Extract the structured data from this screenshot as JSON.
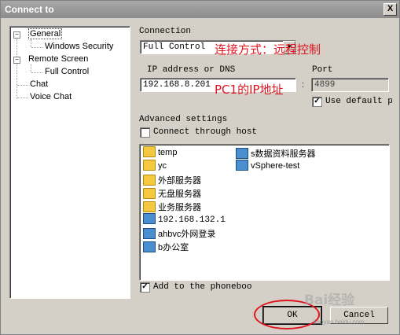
{
  "window": {
    "title": "Connect to",
    "close_label": "X"
  },
  "tree": {
    "items": [
      {
        "label": "General",
        "expanded": true,
        "selected": true
      },
      {
        "label": "Windows Security"
      },
      {
        "label": "Remote Screen",
        "expanded": true
      },
      {
        "label": "Full Control"
      },
      {
        "label": "Chat"
      },
      {
        "label": "Voice Chat"
      }
    ]
  },
  "connection": {
    "heading": "Connection",
    "mode_value": "Full Control",
    "annotation": "连接方式：远程控制"
  },
  "address": {
    "ip_label": "IP address or DNS",
    "ip_value": "192.168.8.201",
    "annotation": "PC1的IP地址",
    "separator": ":",
    "port_label": "Port",
    "port_value": "4899",
    "use_default_label": "Use default p",
    "use_default_checked": true
  },
  "advanced": {
    "heading": "Advanced settings",
    "through_host_label": "Connect through host",
    "through_host_checked": false
  },
  "phonebook": {
    "left_items": [
      {
        "label": "temp",
        "icon": "folder-icon"
      },
      {
        "label": "yc",
        "icon": "folder-icon"
      },
      {
        "label": "外部服务器",
        "icon": "folder-icon"
      },
      {
        "label": "无盘服务器",
        "icon": "folder-icon"
      },
      {
        "label": "业务服务器",
        "icon": "folder-icon"
      },
      {
        "label": "192.168.132.1",
        "icon": "computer-icon"
      },
      {
        "label": "ahbvc外网登录",
        "icon": "computer-icon"
      },
      {
        "label": "b办公室",
        "icon": "computer-icon"
      }
    ],
    "right_items": [
      {
        "label": "s数据资料服务器",
        "icon": "computer-icon"
      },
      {
        "label": "vSphere-test",
        "icon": "computer-icon"
      }
    ],
    "add_label": "Add to the phoneboo",
    "add_checked": true
  },
  "buttons": {
    "ok_label": "OK",
    "cancel_label": "Cancel"
  },
  "watermark": {
    "text": "Bai经验",
    "url": "jingyan.baidu.com"
  },
  "colors": {
    "annotation_red": "#e0141e",
    "title_bar": "#9a9a9a",
    "dialog_bg": "#d4d0c8"
  }
}
